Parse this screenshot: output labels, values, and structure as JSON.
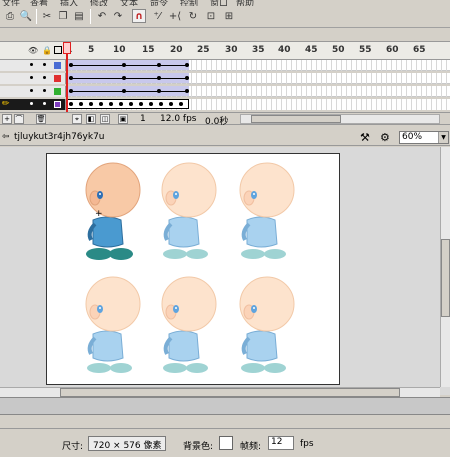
{
  "menubar": {
    "items": [
      "文件",
      "查看",
      "插入",
      "修改",
      "文本",
      "命令",
      "控制",
      "窗口",
      "帮助"
    ]
  },
  "timeline": {
    "ruler": [
      "1",
      "5",
      "10",
      "15",
      "20",
      "25",
      "30",
      "35",
      "40",
      "45",
      "50",
      "55",
      "60",
      "65"
    ],
    "current_frame": "1",
    "fps": "12.0 fps",
    "elapsed": "0.0秒"
  },
  "editbar": {
    "scene_name": "tjluykut3r4jh76yk7u",
    "zoom": "60%"
  },
  "properties": {
    "size_label": "尺寸:",
    "size_value": "720 × 576 像素",
    "bg_label": "背景色:",
    "fps_label": "帧频:",
    "fps_value": "12",
    "fps_unit": "fps"
  },
  "colors": {
    "layer1": "#4a6cd4",
    "layer2": "#e03030",
    "layer3": "#30b030",
    "layer4": "#8040c0",
    "tween_span": "#c8c8ec"
  }
}
